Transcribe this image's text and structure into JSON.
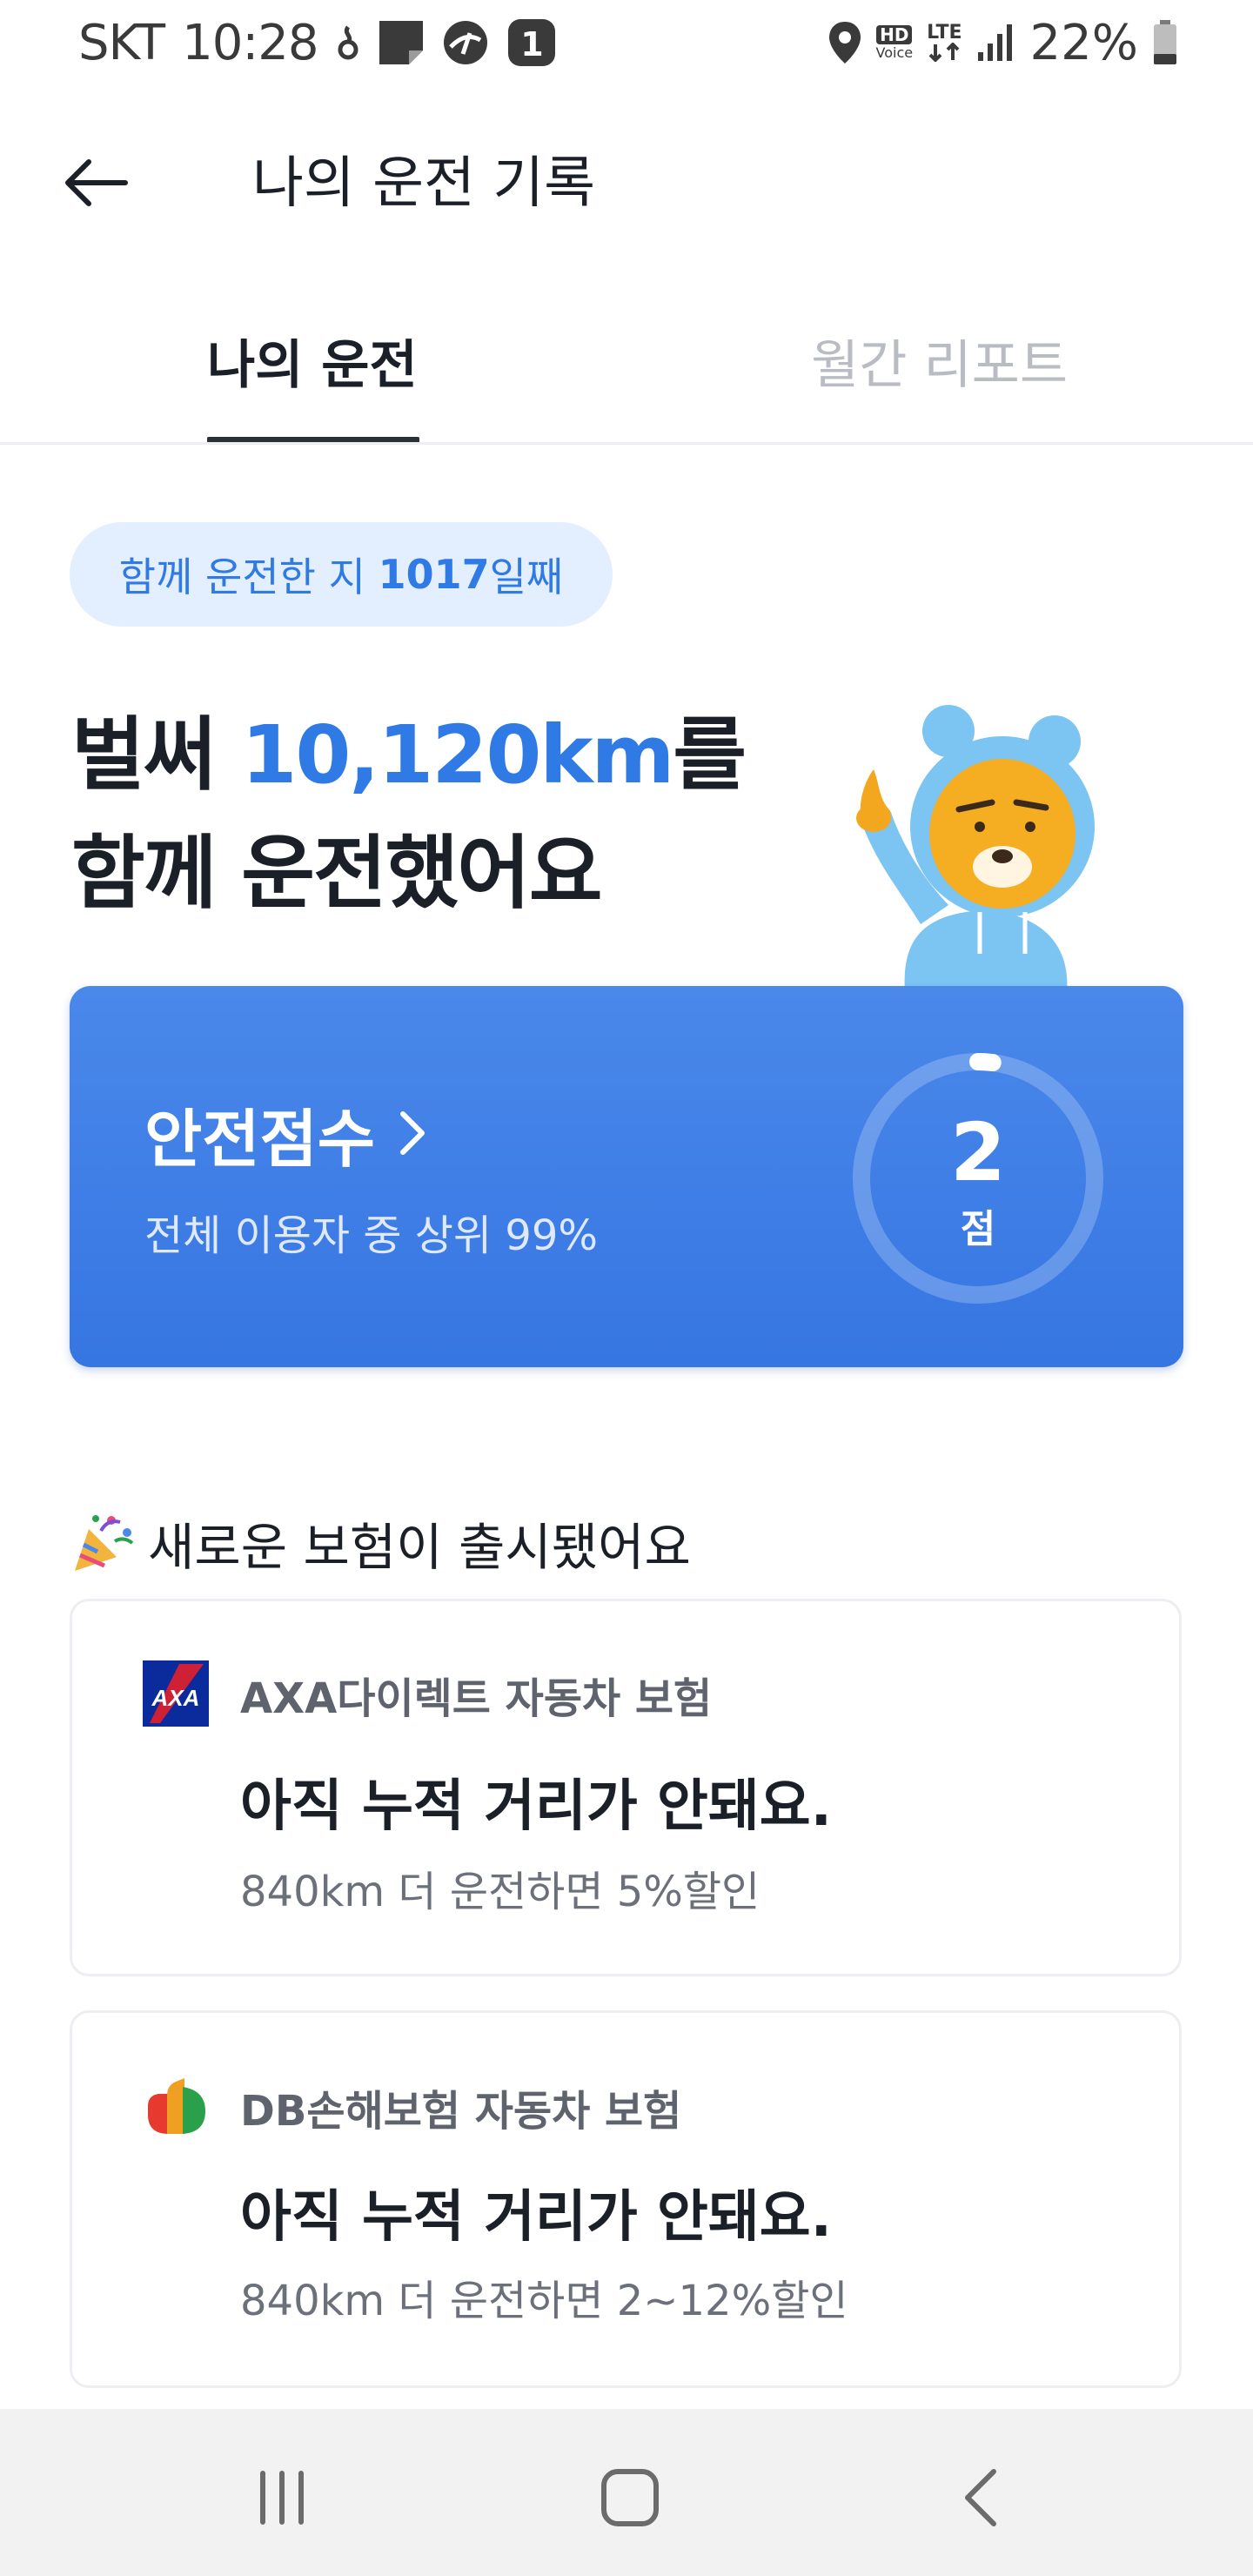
{
  "status_bar": {
    "carrier": "SKT",
    "time": "10:28",
    "notification_badge": "1",
    "hd_label": "HD",
    "voice_label": "Voice",
    "network": "LTE",
    "battery": "22%",
    "icons": [
      "location-icon",
      "signal-icon",
      "battery-icon"
    ]
  },
  "app_bar": {
    "title": "나의 운전 기록"
  },
  "tabs": [
    {
      "label": "나의 운전",
      "active": true
    },
    {
      "label": "월간 리포트",
      "active": false
    }
  ],
  "driving_days": {
    "prefix": "함께 운전한 지 ",
    "days": "1017",
    "suffix": "일째"
  },
  "headline": {
    "line1_prefix": "벌써 ",
    "distance": "10,120km",
    "line1_suffix": "를",
    "line2": "함께 운전했어요"
  },
  "safety": {
    "title": "안전점수",
    "subtitle": "전체 이용자 중 상위 99%",
    "score": "2",
    "unit": "점",
    "score_fraction": 0.02
  },
  "section": {
    "title": "새로운 보험이 출시됐어요"
  },
  "insurance": [
    {
      "name": "AXA다이렉트 자동차 보험",
      "headline": "아직 누적 거리가 안돼요.",
      "description": "840km 더 운전하면 5%할인",
      "logo_text": "AXA",
      "logo_color": "#0b2a9b"
    },
    {
      "name": "DB손해보험 자동차 보험",
      "headline": "아직 누적 거리가 안돼요.",
      "description": "840km 더 운전하면 2~12%할인",
      "logo_colors": [
        "#e63a2e",
        "#f0a020",
        "#2aa04a"
      ]
    }
  ],
  "colors": {
    "accent": "#2f7ae5",
    "card_blue": "#3f7fe6",
    "pill_bg": "#e3efff"
  }
}
